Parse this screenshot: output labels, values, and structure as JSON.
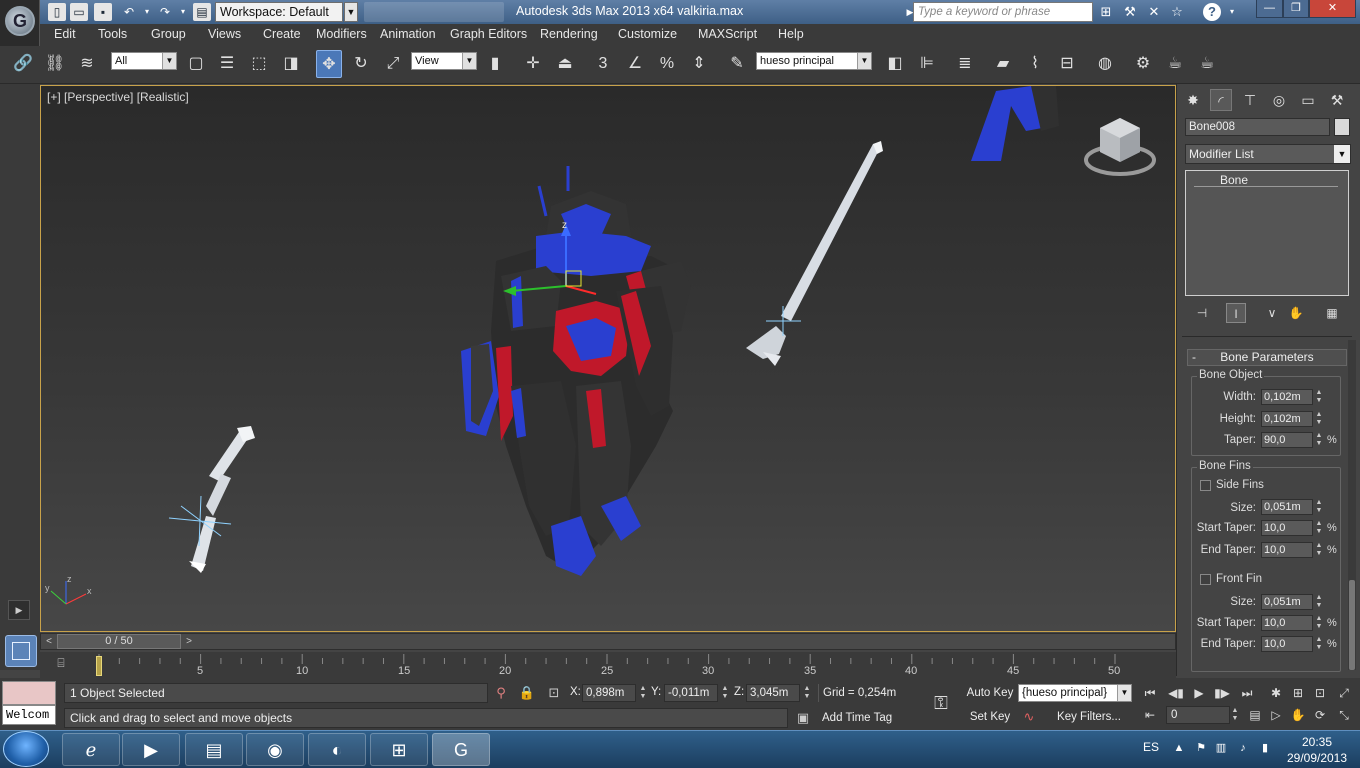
{
  "window": {
    "title": "Autodesk 3ds Max  2013 x64     valkiria.max",
    "workspace": "Workspace: Default",
    "search_placeholder": "Type a keyword or phrase"
  },
  "menu": [
    "Edit",
    "Tools",
    "Group",
    "Views",
    "Create",
    "Modifiers",
    "Animation",
    "Graph Editors",
    "Rendering",
    "Customize",
    "MAXScript",
    "Help"
  ],
  "toolbar": {
    "selection_filter": "All",
    "reference_coord": "View",
    "named_selection": "hueso principal",
    "spinner_snap_label": "3"
  },
  "viewport": {
    "label": "[+] [Perspective] [Realistic]",
    "gizmo_axis_z": "z",
    "axis_x": "x",
    "axis_y": "y",
    "axis_z": "z"
  },
  "command_panel": {
    "object_name": "Bone008",
    "modifier_list": "Modifier List",
    "stack_items": [
      "Bone"
    ],
    "rollout_title": "Bone Parameters",
    "rollout_collapse": "-",
    "bone_object": {
      "title": "Bone Object",
      "width_label": "Width:",
      "width": "0,102m",
      "height_label": "Height:",
      "height": "0,102m",
      "taper_label": "Taper:",
      "taper": "90,0",
      "percent": "%"
    },
    "bone_fins": {
      "title": "Bone Fins",
      "side_fins": "Side Fins",
      "size_label": "Size:",
      "side_size": "0,051m",
      "start_taper_label": "Start Taper:",
      "side_start_taper": "10,0",
      "end_taper_label": "End Taper:",
      "side_end_taper": "10,0",
      "front_fin": "Front Fin",
      "front_size": "0,051m",
      "front_start_taper": "10,0",
      "front_end_taper": "10,0"
    }
  },
  "timeline": {
    "slider_label": "0 / 50",
    "ticks": [
      "5",
      "10",
      "15",
      "20",
      "25",
      "30",
      "35",
      "40",
      "45",
      "50"
    ],
    "prev": "<",
    "next": ">"
  },
  "status": {
    "listener_text": "Welcom",
    "selection": "1 Object Selected",
    "prompt": "Click and drag to select and move objects",
    "x_label": "X:",
    "x": "0,898m",
    "y_label": "Y:",
    "y": "-0,011m",
    "z_label": "Z:",
    "z": "3,045m",
    "grid": "Grid = 0,254m",
    "add_time_tag": "Add Time Tag",
    "auto_key": "Auto Key",
    "set_key": "Set Key",
    "selection_set": "{hueso principal}",
    "key_filters": "Key Filters...",
    "current_frame": "0"
  },
  "taskbar": {
    "language": "ES",
    "time": "20:35",
    "date": "29/09/2013"
  },
  "colors": {
    "accent": "#4b78b8",
    "viewport_border": "#c8a24a",
    "robot_blue": "#2a3fd0",
    "robot_red": "#c0182a",
    "robot_dark": "#2c2c2c",
    "bone": "#d8dde4"
  }
}
